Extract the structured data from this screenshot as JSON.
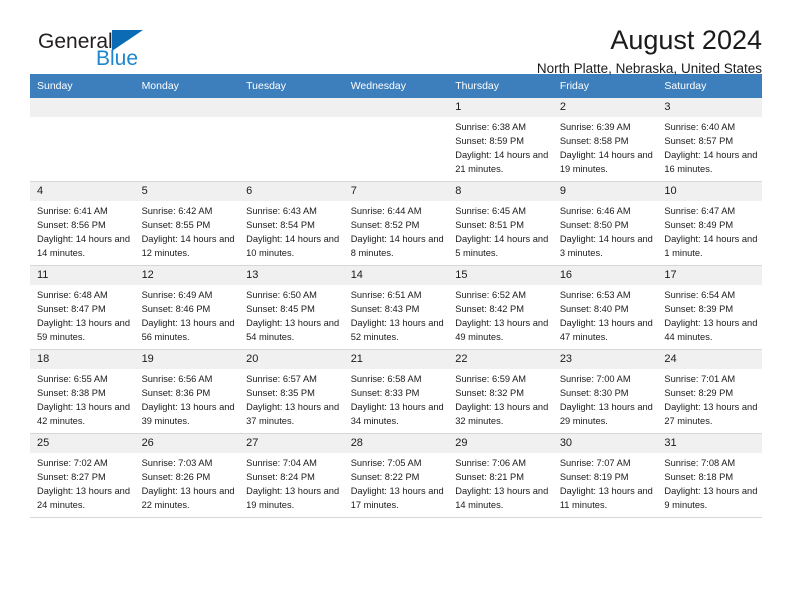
{
  "brand": {
    "name_top": "General",
    "name_bottom": "Blue",
    "logo_icon": "blue-triangle-logo",
    "accent_color": "#1e86d0"
  },
  "header": {
    "title": "August 2024",
    "subtitle": "North Platte, Nebraska, United States"
  },
  "calendar": {
    "header_bg": "#3d7ebd",
    "daynum_bg": "#f0f0f0",
    "weekday_headers": [
      "Sunday",
      "Monday",
      "Tuesday",
      "Wednesday",
      "Thursday",
      "Friday",
      "Saturday"
    ],
    "weeks": [
      [
        {
          "empty": true
        },
        {
          "empty": true
        },
        {
          "empty": true
        },
        {
          "empty": true
        },
        {
          "day": "1",
          "sunrise": "Sunrise: 6:38 AM",
          "sunset": "Sunset: 8:59 PM",
          "daylight": "Daylight: 14 hours and 21 minutes."
        },
        {
          "day": "2",
          "sunrise": "Sunrise: 6:39 AM",
          "sunset": "Sunset: 8:58 PM",
          "daylight": "Daylight: 14 hours and 19 minutes."
        },
        {
          "day": "3",
          "sunrise": "Sunrise: 6:40 AM",
          "sunset": "Sunset: 8:57 PM",
          "daylight": "Daylight: 14 hours and 16 minutes."
        }
      ],
      [
        {
          "day": "4",
          "sunrise": "Sunrise: 6:41 AM",
          "sunset": "Sunset: 8:56 PM",
          "daylight": "Daylight: 14 hours and 14 minutes."
        },
        {
          "day": "5",
          "sunrise": "Sunrise: 6:42 AM",
          "sunset": "Sunset: 8:55 PM",
          "daylight": "Daylight: 14 hours and 12 minutes."
        },
        {
          "day": "6",
          "sunrise": "Sunrise: 6:43 AM",
          "sunset": "Sunset: 8:54 PM",
          "daylight": "Daylight: 14 hours and 10 minutes."
        },
        {
          "day": "7",
          "sunrise": "Sunrise: 6:44 AM",
          "sunset": "Sunset: 8:52 PM",
          "daylight": "Daylight: 14 hours and 8 minutes."
        },
        {
          "day": "8",
          "sunrise": "Sunrise: 6:45 AM",
          "sunset": "Sunset: 8:51 PM",
          "daylight": "Daylight: 14 hours and 5 minutes."
        },
        {
          "day": "9",
          "sunrise": "Sunrise: 6:46 AM",
          "sunset": "Sunset: 8:50 PM",
          "daylight": "Daylight: 14 hours and 3 minutes."
        },
        {
          "day": "10",
          "sunrise": "Sunrise: 6:47 AM",
          "sunset": "Sunset: 8:49 PM",
          "daylight": "Daylight: 14 hours and 1 minute."
        }
      ],
      [
        {
          "day": "11",
          "sunrise": "Sunrise: 6:48 AM",
          "sunset": "Sunset: 8:47 PM",
          "daylight": "Daylight: 13 hours and 59 minutes."
        },
        {
          "day": "12",
          "sunrise": "Sunrise: 6:49 AM",
          "sunset": "Sunset: 8:46 PM",
          "daylight": "Daylight: 13 hours and 56 minutes."
        },
        {
          "day": "13",
          "sunrise": "Sunrise: 6:50 AM",
          "sunset": "Sunset: 8:45 PM",
          "daylight": "Daylight: 13 hours and 54 minutes."
        },
        {
          "day": "14",
          "sunrise": "Sunrise: 6:51 AM",
          "sunset": "Sunset: 8:43 PM",
          "daylight": "Daylight: 13 hours and 52 minutes."
        },
        {
          "day": "15",
          "sunrise": "Sunrise: 6:52 AM",
          "sunset": "Sunset: 8:42 PM",
          "daylight": "Daylight: 13 hours and 49 minutes."
        },
        {
          "day": "16",
          "sunrise": "Sunrise: 6:53 AM",
          "sunset": "Sunset: 8:40 PM",
          "daylight": "Daylight: 13 hours and 47 minutes."
        },
        {
          "day": "17",
          "sunrise": "Sunrise: 6:54 AM",
          "sunset": "Sunset: 8:39 PM",
          "daylight": "Daylight: 13 hours and 44 minutes."
        }
      ],
      [
        {
          "day": "18",
          "sunrise": "Sunrise: 6:55 AM",
          "sunset": "Sunset: 8:38 PM",
          "daylight": "Daylight: 13 hours and 42 minutes."
        },
        {
          "day": "19",
          "sunrise": "Sunrise: 6:56 AM",
          "sunset": "Sunset: 8:36 PM",
          "daylight": "Daylight: 13 hours and 39 minutes."
        },
        {
          "day": "20",
          "sunrise": "Sunrise: 6:57 AM",
          "sunset": "Sunset: 8:35 PM",
          "daylight": "Daylight: 13 hours and 37 minutes."
        },
        {
          "day": "21",
          "sunrise": "Sunrise: 6:58 AM",
          "sunset": "Sunset: 8:33 PM",
          "daylight": "Daylight: 13 hours and 34 minutes."
        },
        {
          "day": "22",
          "sunrise": "Sunrise: 6:59 AM",
          "sunset": "Sunset: 8:32 PM",
          "daylight": "Daylight: 13 hours and 32 minutes."
        },
        {
          "day": "23",
          "sunrise": "Sunrise: 7:00 AM",
          "sunset": "Sunset: 8:30 PM",
          "daylight": "Daylight: 13 hours and 29 minutes."
        },
        {
          "day": "24",
          "sunrise": "Sunrise: 7:01 AM",
          "sunset": "Sunset: 8:29 PM",
          "daylight": "Daylight: 13 hours and 27 minutes."
        }
      ],
      [
        {
          "day": "25",
          "sunrise": "Sunrise: 7:02 AM",
          "sunset": "Sunset: 8:27 PM",
          "daylight": "Daylight: 13 hours and 24 minutes."
        },
        {
          "day": "26",
          "sunrise": "Sunrise: 7:03 AM",
          "sunset": "Sunset: 8:26 PM",
          "daylight": "Daylight: 13 hours and 22 minutes."
        },
        {
          "day": "27",
          "sunrise": "Sunrise: 7:04 AM",
          "sunset": "Sunset: 8:24 PM",
          "daylight": "Daylight: 13 hours and 19 minutes."
        },
        {
          "day": "28",
          "sunrise": "Sunrise: 7:05 AM",
          "sunset": "Sunset: 8:22 PM",
          "daylight": "Daylight: 13 hours and 17 minutes."
        },
        {
          "day": "29",
          "sunrise": "Sunrise: 7:06 AM",
          "sunset": "Sunset: 8:21 PM",
          "daylight": "Daylight: 13 hours and 14 minutes."
        },
        {
          "day": "30",
          "sunrise": "Sunrise: 7:07 AM",
          "sunset": "Sunset: 8:19 PM",
          "daylight": "Daylight: 13 hours and 11 minutes."
        },
        {
          "day": "31",
          "sunrise": "Sunrise: 7:08 AM",
          "sunset": "Sunset: 8:18 PM",
          "daylight": "Daylight: 13 hours and 9 minutes."
        }
      ]
    ]
  }
}
